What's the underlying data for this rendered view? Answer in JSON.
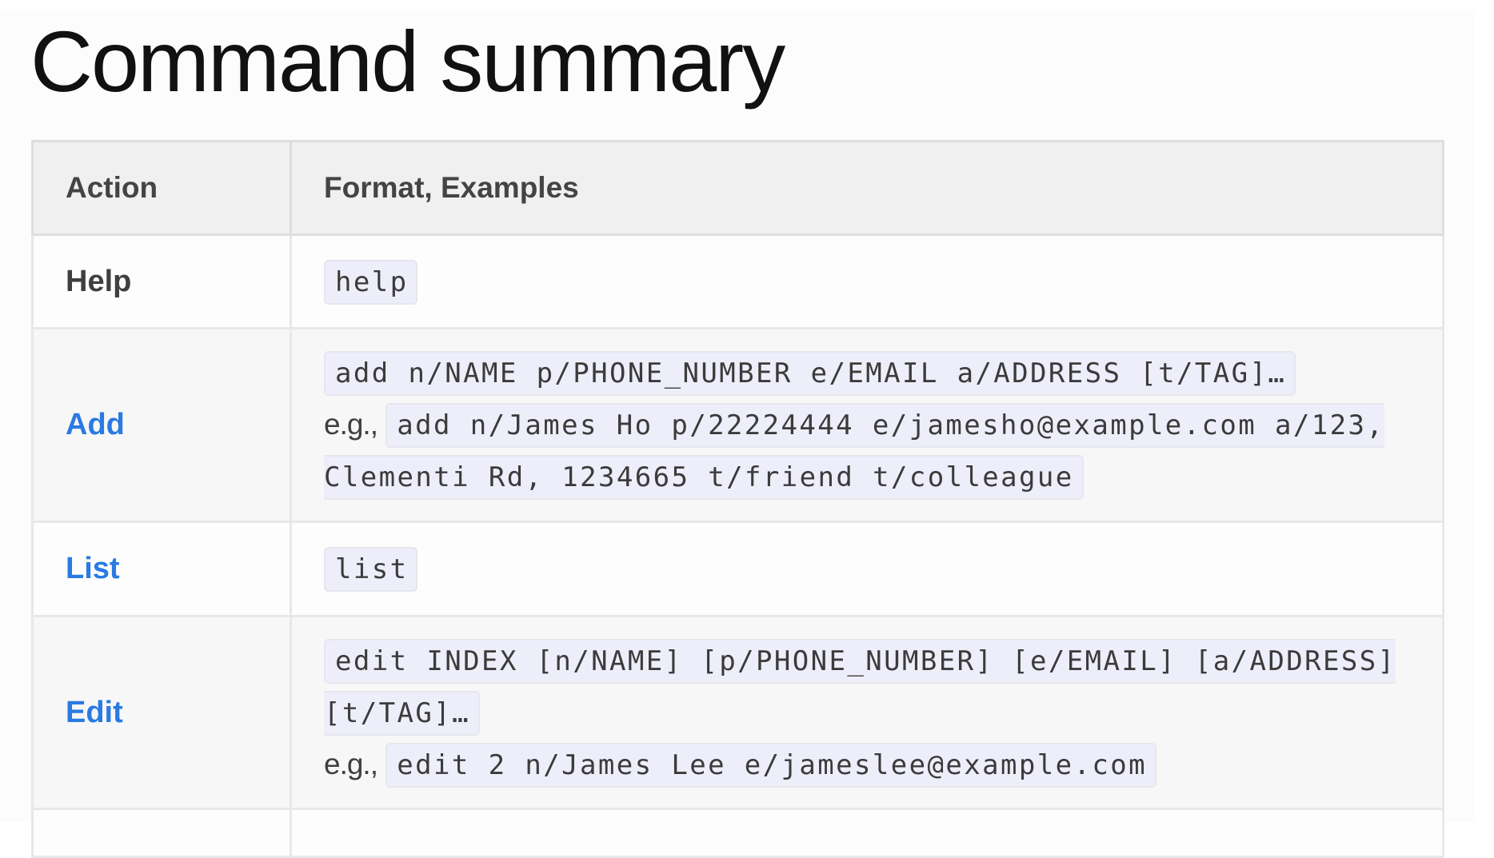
{
  "page": {
    "title": "Command summary"
  },
  "table": {
    "headers": [
      "Action",
      "Format, Examples"
    ],
    "rows": [
      {
        "action": "Help",
        "action_is_link": false,
        "format": "help",
        "example_prefix": "",
        "example": ""
      },
      {
        "action": "Add",
        "action_is_link": true,
        "format": "add n/NAME p/PHONE_NUMBER e/EMAIL a/ADDRESS [t/TAG]…",
        "example_prefix": "e.g.,",
        "example": "add n/James Ho p/22224444 e/jamesho@example.com a/123, Clementi Rd, 1234665 t/friend t/colleague"
      },
      {
        "action": "List",
        "action_is_link": true,
        "format": "list",
        "example_prefix": "",
        "example": ""
      },
      {
        "action": "Edit",
        "action_is_link": true,
        "format": "edit INDEX [n/NAME] [p/PHONE_NUMBER] [e/EMAIL] [a/ADDRESS] [t/TAG]…",
        "example_prefix": "e.g.,",
        "example": "edit 2 n/James Lee e/jameslee@example.com"
      }
    ]
  },
  "colors": {
    "link": "#2a7ae2",
    "code_bg": "#eeeefb",
    "header_bg": "#f0f0f0"
  }
}
